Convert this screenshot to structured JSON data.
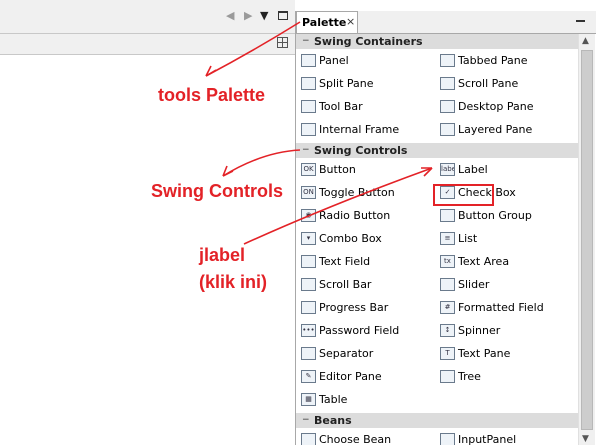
{
  "palette": {
    "title": "Palette",
    "close_glyph": "×",
    "categories": [
      {
        "name": "Swing Containers",
        "items": [
          {
            "label": "Panel",
            "icon": "panel-icon",
            "glyph": ""
          },
          {
            "label": "Tabbed Pane",
            "icon": "tabbed-pane-icon",
            "glyph": ""
          },
          {
            "label": "Split Pane",
            "icon": "split-pane-icon",
            "glyph": ""
          },
          {
            "label": "Scroll Pane",
            "icon": "scroll-pane-icon",
            "glyph": ""
          },
          {
            "label": "Tool Bar",
            "icon": "tool-bar-icon",
            "glyph": ""
          },
          {
            "label": "Desktop Pane",
            "icon": "desktop-pane-icon",
            "glyph": ""
          },
          {
            "label": "Internal Frame",
            "icon": "internal-frame-icon",
            "glyph": ""
          },
          {
            "label": "Layered Pane",
            "icon": "layered-pane-icon",
            "glyph": ""
          }
        ]
      },
      {
        "name": "Swing Controls",
        "items": [
          {
            "label": "Button",
            "icon": "button-icon",
            "glyph": "OK"
          },
          {
            "label": "Label",
            "icon": "label-icon",
            "glyph": "label"
          },
          {
            "label": "Toggle Button",
            "icon": "toggle-button-icon",
            "glyph": "ON"
          },
          {
            "label": "Check Box",
            "icon": "check-box-icon",
            "glyph": "✓"
          },
          {
            "label": "Radio Button",
            "icon": "radio-button-icon",
            "glyph": "◉"
          },
          {
            "label": "Button Group",
            "icon": "button-group-icon",
            "glyph": ""
          },
          {
            "label": "Combo Box",
            "icon": "combo-box-icon",
            "glyph": "▾"
          },
          {
            "label": "List",
            "icon": "list-icon",
            "glyph": "≡"
          },
          {
            "label": "Text Field",
            "icon": "text-field-icon",
            "glyph": ""
          },
          {
            "label": "Text Area",
            "icon": "text-area-icon",
            "glyph": "tx"
          },
          {
            "label": "Scroll Bar",
            "icon": "scroll-bar-icon",
            "glyph": ""
          },
          {
            "label": "Slider",
            "icon": "slider-icon",
            "glyph": ""
          },
          {
            "label": "Progress Bar",
            "icon": "progress-bar-icon",
            "glyph": ""
          },
          {
            "label": "Formatted Field",
            "icon": "formatted-field-icon",
            "glyph": "#"
          },
          {
            "label": "Password Field",
            "icon": "password-field-icon",
            "glyph": "•••"
          },
          {
            "label": "Spinner",
            "icon": "spinner-icon",
            "glyph": "↕"
          },
          {
            "label": "Separator",
            "icon": "separator-icon",
            "glyph": ""
          },
          {
            "label": "Text Pane",
            "icon": "text-pane-icon",
            "glyph": "T"
          },
          {
            "label": "Editor Pane",
            "icon": "editor-pane-icon",
            "glyph": "✎"
          },
          {
            "label": "Tree",
            "icon": "tree-icon",
            "glyph": ""
          },
          {
            "label": "Table",
            "icon": "table-icon",
            "glyph": "▦"
          }
        ]
      },
      {
        "name": "Beans",
        "items": [
          {
            "label": "Choose Bean",
            "icon": "choose-bean-icon",
            "glyph": ""
          },
          {
            "label": "InputPanel",
            "icon": "input-panel-icon",
            "glyph": ""
          }
        ]
      }
    ],
    "highlighted_item": "Label"
  },
  "annotations": {
    "tools_palette": "tools Palette",
    "swing_controls": "Swing Controls",
    "jlabel": "jlabel",
    "click_hint": "(klik ini)"
  },
  "colors": {
    "annotation": "#e32227",
    "category_header": "#dcdcdc"
  }
}
